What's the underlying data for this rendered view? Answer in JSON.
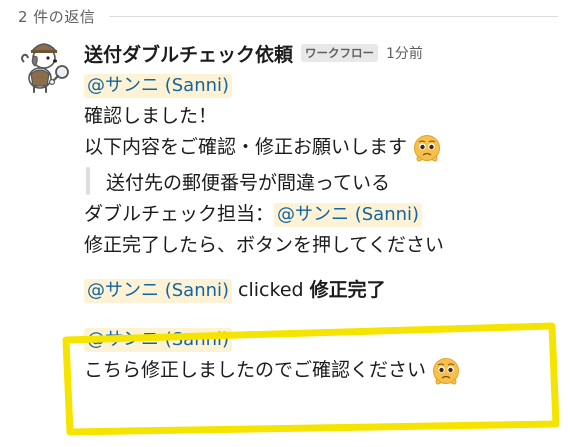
{
  "thread": {
    "reply_count": "2 件の返信"
  },
  "message": {
    "sender": "送付ダブルチェック依頼",
    "app_badge": "ワークフロー",
    "timestamp": "1分前",
    "mention": "@サンニ (Sanni)",
    "line1": "確認しました！",
    "line2": "以下内容をご確認・修正お願いします",
    "quote": "送付先の郵便番号が間違っている",
    "line3_prefix": "ダブルチェック担当：",
    "line3_mention": "@サンニ (Sanni)",
    "line4": "修正完了したら、ボタンを押してください"
  },
  "action": {
    "mention": "@サンニ (Sanni)",
    "clicked": "clicked",
    "button_name": "修正完了"
  },
  "reply": {
    "mention": "@サンニ (Sanni)",
    "text": "こちら修正しましたのでご確認ください"
  },
  "icons": {
    "avatar": "detective-dog-avatar",
    "emoji": "pleading-face-emoji"
  },
  "colors": {
    "mention_text": "#1264a3",
    "mention_bg": "#fdf3d4",
    "highlight": "#f5e400"
  }
}
